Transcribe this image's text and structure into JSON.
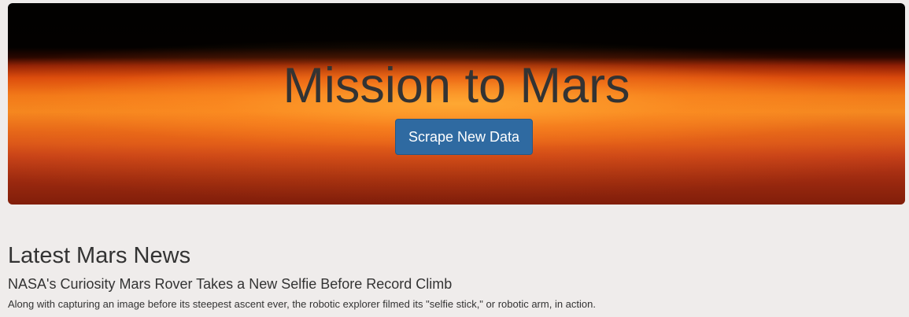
{
  "hero": {
    "title": "Mission to Mars",
    "button_label": "Scrape New Data"
  },
  "news": {
    "heading": "Latest Mars News",
    "title": "NASA's Curiosity Mars Rover Takes a New Selfie Before Record Climb",
    "teaser": "Along with capturing an image before its steepest ascent ever, the robotic explorer filmed its \"selfie stick,\" or robotic arm, in action."
  },
  "colors": {
    "page_background": "#efeceb",
    "button_background": "#2f6aa1",
    "text": "#333333"
  }
}
